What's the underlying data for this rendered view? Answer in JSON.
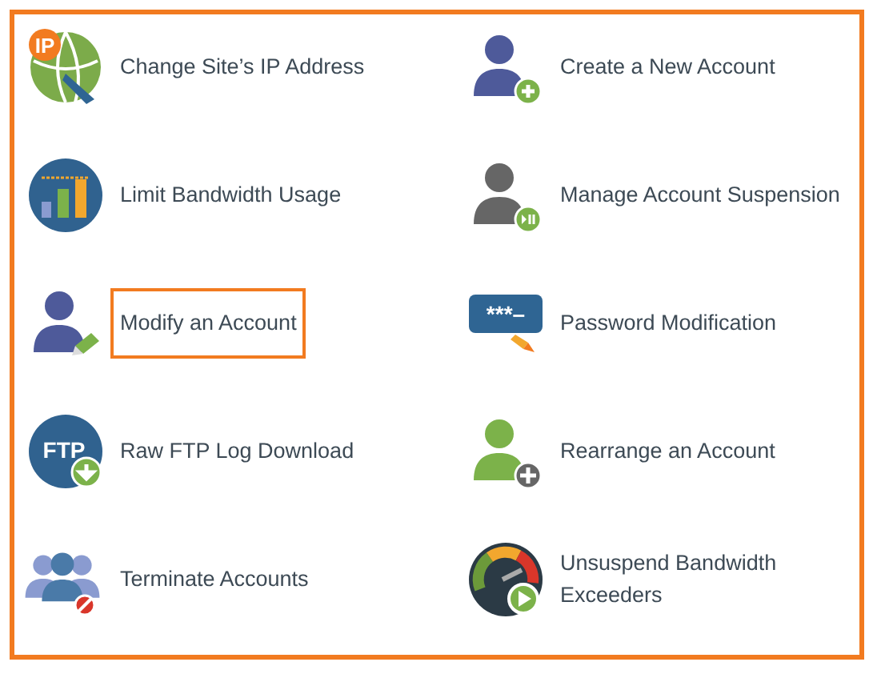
{
  "tools": [
    {
      "label": "Change Site’s IP Address",
      "kind": "globe",
      "icon_text": "IP",
      "highlighted": false
    },
    {
      "label": "Create a New Account",
      "kind": "user-add",
      "highlighted": false
    },
    {
      "label": "Limit Bandwidth Usage",
      "kind": "bars",
      "highlighted": false
    },
    {
      "label": "Manage Account Suspension",
      "kind": "user-pause",
      "highlighted": false
    },
    {
      "label": "Modify an Account",
      "kind": "user-edit",
      "highlighted": true
    },
    {
      "label": "Password Modification",
      "kind": "password",
      "icon_text": "***–",
      "highlighted": false
    },
    {
      "label": "Raw FTP Log Download",
      "kind": "ftp",
      "icon_text": "FTP",
      "highlighted": false
    },
    {
      "label": "Rearrange an Account",
      "kind": "user-move",
      "highlighted": false
    },
    {
      "label": "Terminate Accounts",
      "kind": "users-block",
      "highlighted": false
    },
    {
      "label": "Unsuspend Bandwidth Exceeders",
      "kind": "gauge",
      "highlighted": false
    }
  ]
}
